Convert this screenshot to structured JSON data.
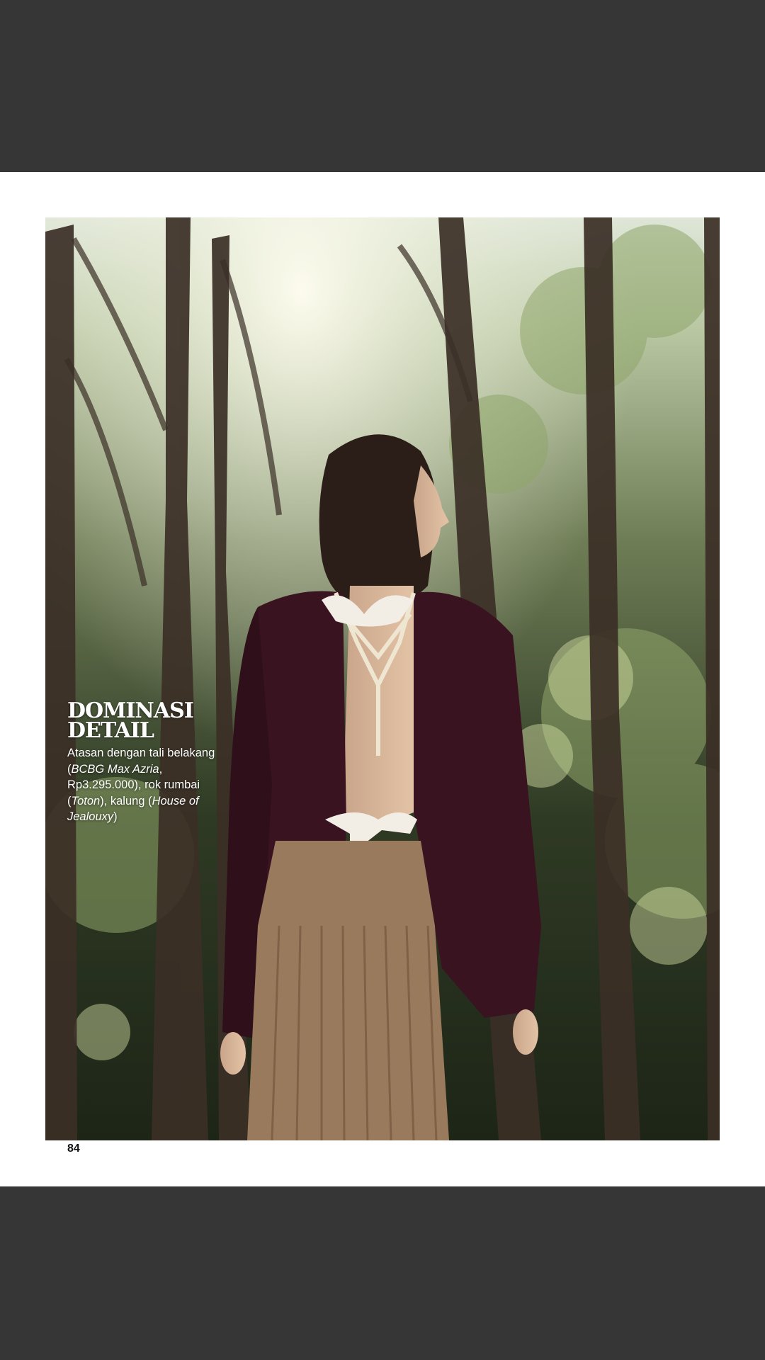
{
  "caption": {
    "title": "DOMINASI\nDETAIL",
    "segments": [
      {
        "text": "Atasan dengan tali belakang (",
        "italic": false
      },
      {
        "text": "BCBG Max Azria",
        "italic": true
      },
      {
        "text": ", Rp3.295.000), rok rumbai (",
        "italic": false
      },
      {
        "text": "Toton",
        "italic": true
      },
      {
        "text": "), kalung (",
        "italic": false
      },
      {
        "text": "House of Jealouxy",
        "italic": true
      },
      {
        "text": ")",
        "italic": false
      }
    ]
  },
  "page_number": "84",
  "colors": {
    "viewer_background": "#363636",
    "page": "#ffffff",
    "cardigan": "#3a1320",
    "skirt": "#9a7a5c"
  }
}
